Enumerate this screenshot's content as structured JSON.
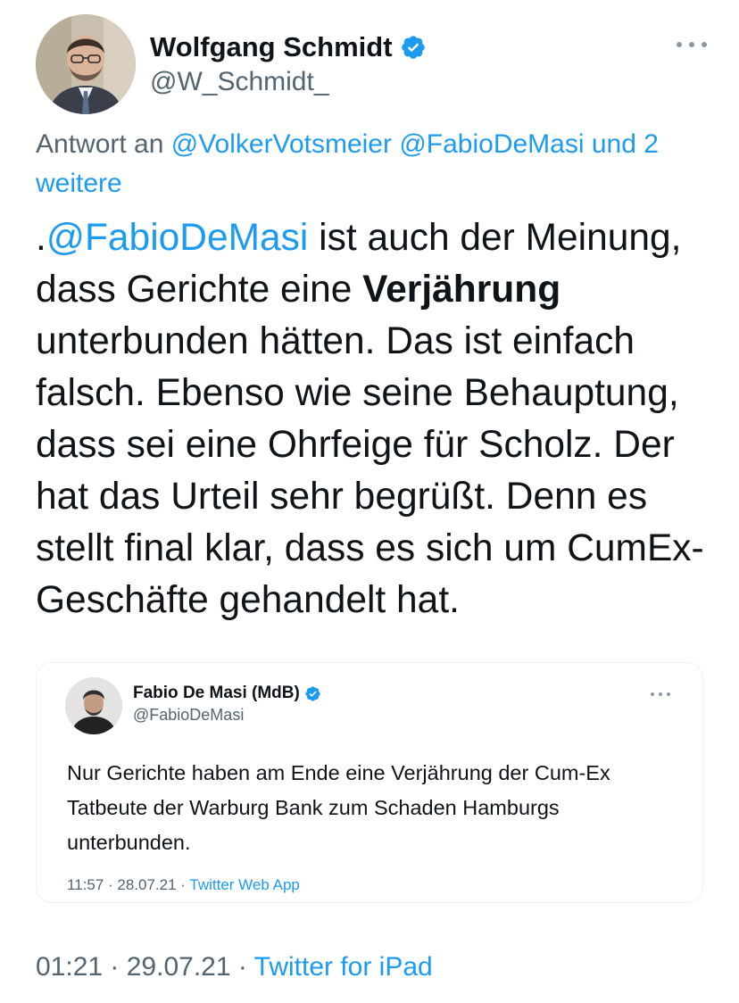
{
  "tweet": {
    "author": {
      "name": "Wolfgang Schmidt",
      "handle": "@W_Schmidt_",
      "verified": true
    },
    "reply_to": {
      "prefix": "Antwort an ",
      "user1": "@VolkerVotsmeier",
      "separator": " ",
      "user2": "@FabioDeMasi",
      "suffix": " und 2 weitere"
    },
    "text": {
      "lead": ".",
      "mention": "@FabioDeMasi",
      "part1": " ist auch der Meinung, dass Gerichte eine ",
      "bold": "Verjährung",
      "part2": " unterbunden hätten. Das ist einfach falsch. Ebenso wie seine Behauptung, dass sei eine Ohrfeige für Scholz. Der hat das Urteil sehr begrüßt. Denn es stellt final klar, dass es sich um CumEx-Geschäfte gehandelt hat."
    },
    "time": "01:21",
    "dot": " · ",
    "date": "29.07.21",
    "source": "Twitter for iPad"
  },
  "quote": {
    "author": {
      "name": "Fabio De Masi (MdB)",
      "handle": "@FabioDeMasi",
      "verified": true
    },
    "text": "Nur Gerichte haben am Ende eine Verjährung der Cum-Ex Tatbeute der Warburg Bank zum Schaden Hamburgs unterbunden.",
    "time": "11:57",
    "dot": " · ",
    "date": "28.07.21",
    "source": "Twitter Web App"
  },
  "colors": {
    "accent": "#1d9bf0",
    "secondary_text": "#536471",
    "primary_text": "#0f1419",
    "border": "#eff3f4"
  },
  "icons": {
    "verified": "verified-badge-icon",
    "more": "more-horizontal-icon"
  }
}
